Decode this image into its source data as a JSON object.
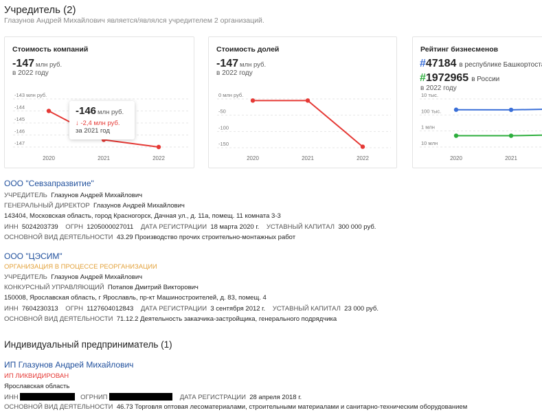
{
  "header": {
    "title": "Учредитель (2)",
    "subtitle": "Глазунов Андрей Михайлович является/являлся учредителем 2 организаций."
  },
  "cards": {
    "companies": {
      "title": "Стоимость компаний",
      "value": "-147",
      "unit": "млн руб.",
      "year": "в 2022 году"
    },
    "shares": {
      "title": "Стоимость долей",
      "value": "-147",
      "unit": "млн руб.",
      "year": "в 2022 году"
    },
    "rating": {
      "title": "Рейтинг бизнесменов",
      "regional_hash": "#",
      "regional_rank": "47184",
      "regional_loc": "в республике Башкортостан",
      "national_hash": "#",
      "national_rank": "1972965",
      "national_loc": "в России",
      "year": "в 2022 году"
    }
  },
  "tooltip": {
    "value": "-146",
    "unit": "млн руб.",
    "delta": "↓ -2,4 млн руб.",
    "year": "за 2021 год"
  },
  "chart_data": [
    {
      "type": "line",
      "title": "Стоимость компаний",
      "x": [
        "2020",
        "2021",
        "2022"
      ],
      "y_ticks": [
        "-143 млн руб.",
        "-144",
        "-145",
        "-146",
        "-147"
      ],
      "ylim": [
        -147,
        -143
      ],
      "series": [
        {
          "values": [
            -144,
            -146.4,
            -147
          ],
          "color": "#e53935"
        }
      ]
    },
    {
      "type": "line",
      "title": "Стоимость долей",
      "x": [
        "2020",
        "2021",
        "2022"
      ],
      "y_ticks": [
        "0 млн руб.",
        "-50",
        "-100",
        "-150"
      ],
      "ylim": [
        -150,
        0
      ],
      "series": [
        {
          "values": [
            -5,
            -5,
            -147
          ],
          "color": "#e53935"
        }
      ]
    },
    {
      "type": "line",
      "title": "Рейтинг бизнесменов",
      "x": [
        "2020",
        "2021"
      ],
      "y_ticks": [
        "10 тыс.",
        "100 тыс.",
        "1 млн",
        "10 млн"
      ],
      "log_scale": true,
      "series": [
        {
          "values": [
            47184,
            48000
          ],
          "color": "#3a6fd8"
        },
        {
          "values": [
            1972965,
            1972965
          ],
          "color": "#2cae3c"
        }
      ]
    }
  ],
  "orgs": [
    {
      "name": "ООО \"Севзапразвитие\"",
      "founder_label": "УЧРЕДИТЕЛЬ",
      "founder": "Глазунов Андрей Михайлович",
      "director_label": "ГЕНЕРАЛЬНЫЙ ДИРЕКТОР",
      "director": "Глазунов Андрей Михайлович",
      "address": "143404, Московская область, город Красногорск, Дачная ул., д. 11а, помещ. 11 комната 3-3",
      "inn_label": "ИНН",
      "inn": "5024203739",
      "ogrn_label": "ОГРН",
      "ogrn": "1205000027011",
      "regdate_label": "ДАТА РЕГИСТРАЦИИ",
      "regdate": "18 марта 2020 г.",
      "capital_label": "УСТАВНЫЙ КАПИТАЛ",
      "capital": "300 000 руб.",
      "activity_label": "ОСНОВНОЙ ВИД ДЕЯТЕЛЬНОСТИ",
      "activity": "43.29 Производство прочих строительно-монтажных работ"
    },
    {
      "name": "ООО \"ЦЭСИМ\"",
      "status": "ОРГАНИЗАЦИЯ В ПРОЦЕССЕ РЕОРГАНИЗАЦИИ",
      "founder_label": "УЧРЕДИТЕЛЬ",
      "founder": "Глазунов Андрей Михайлович",
      "director_label": "КОНКУРСНЫЙ УПРАВЛЯЮЩИЙ",
      "director": "Потапов Дмитрий Викторович",
      "address": "150008, Ярославская область, г Ярославль, пр-кт Машиностроителей, д. 83, помещ. 4",
      "inn_label": "ИНН",
      "inn": "7604230313",
      "ogrn_label": "ОГРН",
      "ogrn": "1127604012843",
      "regdate_label": "ДАТА РЕГИСТРАЦИИ",
      "regdate": "3 сентября 2012 г.",
      "capital_label": "УСТАВНЫЙ КАПИТАЛ",
      "capital": "23 000 руб.",
      "activity_label": "ОСНОВНОЙ ВИД ДЕЯТЕЛЬНОСТИ",
      "activity": "71.12.2 Деятельность заказчика-застройщика, генерального подрядчика"
    }
  ],
  "ip_section": {
    "title": "Индивидуальный предприниматель (1)",
    "name": "ИП Глазунов Андрей Михайлович",
    "status": "ИП ЛИКВИДИРОВАН",
    "region": "Ярославская область",
    "inn_label": "ИНН",
    "ogrnip_label": "ОГРНИП",
    "regdate_label": "ДАТА РЕГИСТРАЦИИ",
    "regdate": "28 апреля 2018 г.",
    "activity_label": "ОСНОВНОЙ ВИД ДЕЯТЕЛЬНОСТИ",
    "activity": "46.73 Торговля оптовая лесоматериалами, строительными материалами и санитарно-техническим оборудованием"
  }
}
